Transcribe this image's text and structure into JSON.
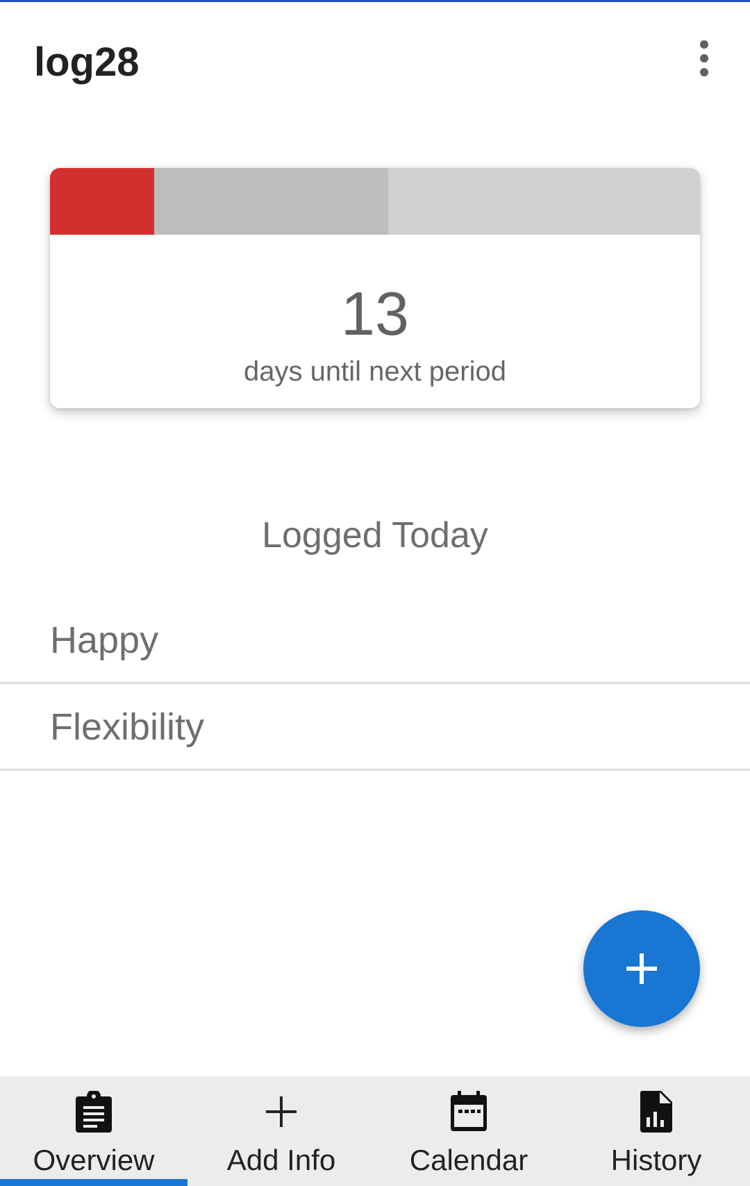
{
  "app": {
    "title": "log28"
  },
  "menu": {
    "icon": "more-vert-icon"
  },
  "cycle": {
    "bar_segments": [
      {
        "name": "period",
        "color": "#d32f2f",
        "fraction": 0.16
      },
      {
        "name": "elapsed",
        "color": "#bdbdbd",
        "fraction": 0.36
      },
      {
        "name": "remaining",
        "color": "#d0d0d0",
        "fraction": 0.48
      }
    ],
    "days_count": "13",
    "days_caption": "days until next period"
  },
  "logged_today": {
    "title": "Logged Today",
    "items": [
      "Happy",
      "Flexibility"
    ]
  },
  "fab": {
    "icon": "plus-icon",
    "color": "#1976d2"
  },
  "bottom_nav": {
    "active_index": 0,
    "items": [
      {
        "label": "Overview",
        "icon": "clipboard-icon"
      },
      {
        "label": "Add Info",
        "icon": "plus-icon"
      },
      {
        "label": "Calendar",
        "icon": "calendar-icon"
      },
      {
        "label": "History",
        "icon": "chart-file-icon"
      }
    ]
  }
}
